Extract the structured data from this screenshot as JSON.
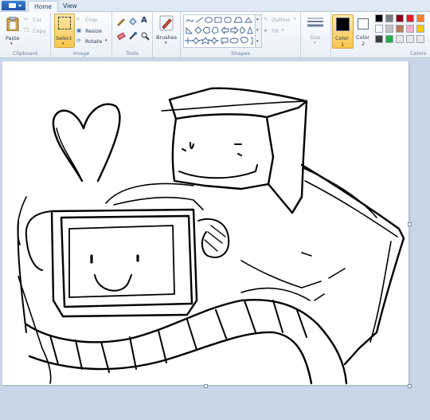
{
  "tabs": {
    "home": "Home",
    "view": "View"
  },
  "clipboard": {
    "paste": "Paste",
    "cut": "Cut",
    "copy": "Copy",
    "label": "Clipboard"
  },
  "image": {
    "select": "Select",
    "crop": "Crop",
    "resize": "Resize",
    "rotate": "Rotate",
    "label": "Image"
  },
  "tools": {
    "label": "Tools"
  },
  "brushes": {
    "label": "Brushes"
  },
  "shapes": {
    "outline": "Outline",
    "fill": "Fill",
    "label": "Shapes"
  },
  "size": {
    "label": "Size"
  },
  "color1": {
    "label": "Color",
    "num": "1",
    "value": "#000000"
  },
  "color2": {
    "label": "Color",
    "num": "2",
    "value": "#ffffff"
  },
  "colors": {
    "label": "Colors",
    "palette": [
      "#000000",
      "#7f7f7f",
      "#880015",
      "#ed1c24",
      "#ff7f27",
      "#ffffff",
      "#c3c3c3",
      "#b97a57",
      "#ffaec9",
      "#ffc90e",
      "#404040",
      "#22b14c",
      "#e8e8e8",
      "#e8e8e8",
      "#e8e8e8"
    ]
  }
}
